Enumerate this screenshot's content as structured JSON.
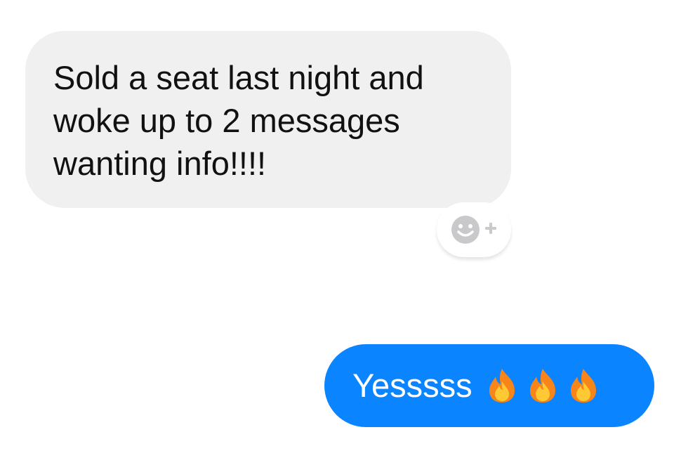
{
  "conversation": {
    "incoming": {
      "text": "Sold a seat last night and\nwoke up to 2 messages\nwanting info!!!!"
    },
    "reaction": {
      "icon": "smiley-plus-icon"
    },
    "outgoing": {
      "text": "Yesssss",
      "emojis": [
        "fire-icon",
        "fire-icon",
        "fire-icon"
      ]
    }
  },
  "colors": {
    "incoming_bubble": "#f0f0f0",
    "outgoing_bubble": "#0a84ff",
    "reaction_icon": "#c9c9cc"
  }
}
